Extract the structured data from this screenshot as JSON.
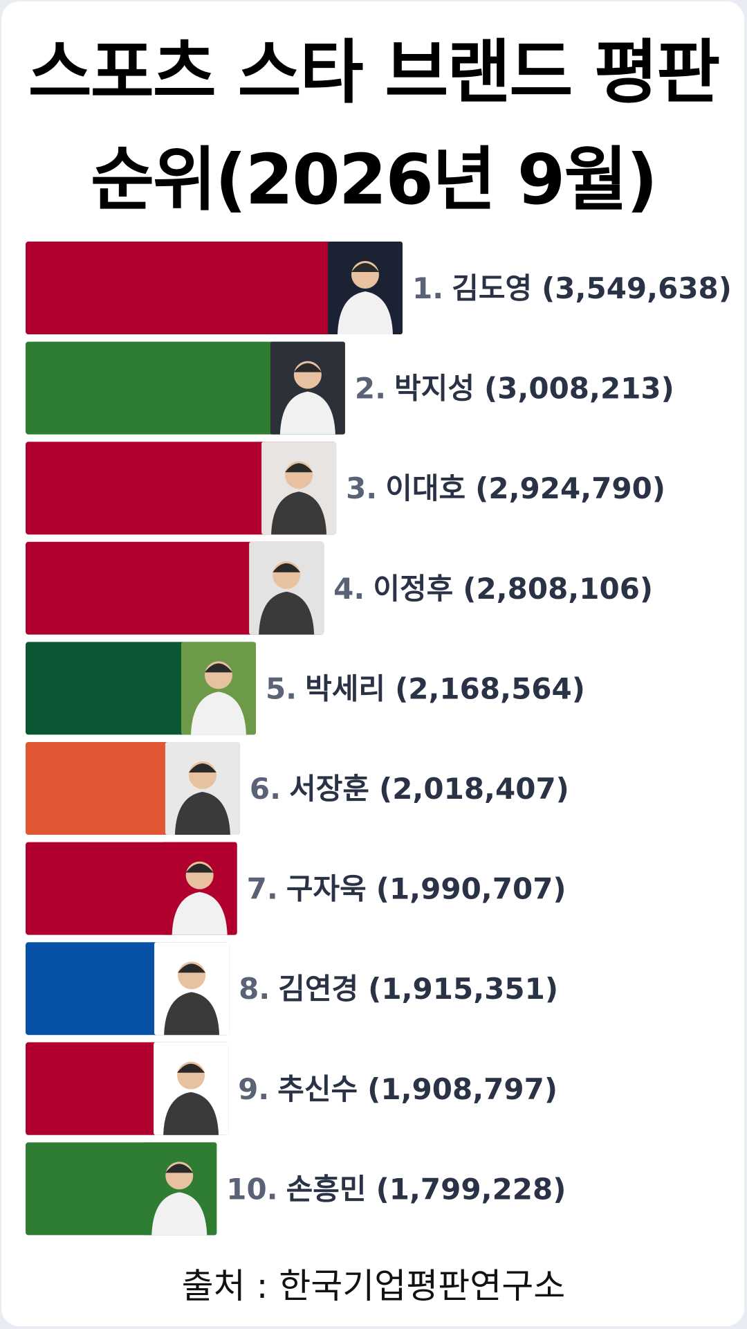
{
  "title_line1": "스포츠 스타 브랜드 평판",
  "title_line2": "순위(2026년 9월)",
  "source": "출처 : 한국기업평판연구소",
  "chart_data": {
    "type": "bar",
    "orientation": "horizontal",
    "ranks": [
      "1.",
      "2.",
      "3.",
      "4.",
      "5.",
      "6.",
      "7.",
      "8.",
      "9.",
      "10."
    ],
    "categories": [
      "김도영",
      "박지성",
      "이대호",
      "이정후",
      "박세리",
      "서장훈",
      "구자욱",
      "김연경",
      "추신수",
      "손흥민"
    ],
    "values": [
      3549638,
      3008213,
      2924790,
      2808106,
      2168564,
      2018407,
      1990707,
      1915351,
      1908797,
      1799228
    ],
    "value_labels": [
      "(3,549,638)",
      "(3,008,213)",
      "(2,924,790)",
      "(2,808,106)",
      "(2,168,564)",
      "(2,018,407)",
      "(1,990,707)",
      "(1,915,351)",
      "(1,908,797)",
      "(1,799,228)"
    ],
    "bar_colors": [
      "#b1002d",
      "#2e7d32",
      "#b1002d",
      "#b1002d",
      "#0b5734",
      "#e15633",
      "#b1002d",
      "#0752a6",
      "#b1002d",
      "#2e7d32"
    ],
    "photo_backgrounds": [
      "#1a2234",
      "#2b3039",
      "#e7e4e1",
      "#e3e3e3",
      "#6c9a48",
      "#e8e8e8",
      "#b1002d",
      "#ffffff",
      "#ffffff",
      "#2e7d32"
    ],
    "photo_icons": [
      "baseball-player-photo-icon",
      "suit-man-photo-icon",
      "jacket-man-photo-icon",
      "baseball-player-photo-icon",
      "golfer-photo-icon",
      "suit-man-photo-icon",
      "baseball-player-photo-icon",
      "woman-photo-icon",
      "baseball-player-photo-icon",
      "soccer-player-photo-icon"
    ]
  }
}
